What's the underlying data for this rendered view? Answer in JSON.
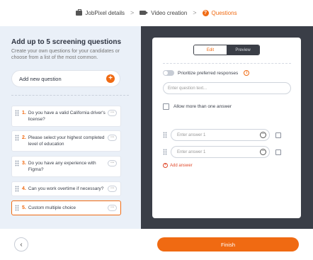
{
  "stepper": {
    "steps": [
      {
        "label": "JobPixel details",
        "icon": "briefcase-icon",
        "active": false
      },
      {
        "label": "Video creation",
        "icon": "video-camera-icon",
        "active": false
      },
      {
        "label": "Questions",
        "icon": "question-circle-icon",
        "active": true
      }
    ],
    "separator": ">"
  },
  "left_panel": {
    "title": "Add up to 5 screening questions",
    "subtitle": "Create your own questions for your candidates or choose from a list of the most common.",
    "add_question_label": "Add new question",
    "add_icon": "+",
    "questions": [
      {
        "number": "1.",
        "text": "Do you have a valid California driver's license?",
        "more": "···"
      },
      {
        "number": "2.",
        "text": "Please select your highest completed level of education",
        "more": "···"
      },
      {
        "number": "3.",
        "text": "Do you have any experience with Figma?",
        "more": "···"
      },
      {
        "number": "4.",
        "text": "Can you work overtime if necessary?",
        "more": "···"
      },
      {
        "number": "5.",
        "text": "Custom multiple choice",
        "more": "···"
      }
    ]
  },
  "editor": {
    "tabs": {
      "edit": "Edit",
      "preview": "Preview"
    },
    "toggle_label": "Prioritize preferred responses",
    "info_icon": "i",
    "question_placeholder": "Enter question text...",
    "allow_multiple_label": "Allow more than one answer",
    "answers": [
      {
        "placeholder": "Enter answer 1"
      },
      {
        "placeholder": "Enter answer 1"
      }
    ],
    "add_answer_label": "Add answer",
    "add_answer_icon": "+"
  },
  "footer": {
    "back_icon": "‹",
    "finish_label": "Finish"
  },
  "colors": {
    "accent": "#f06a12",
    "dark_panel": "#3a3e47",
    "left_panel_bg": "#eaf0f8"
  }
}
